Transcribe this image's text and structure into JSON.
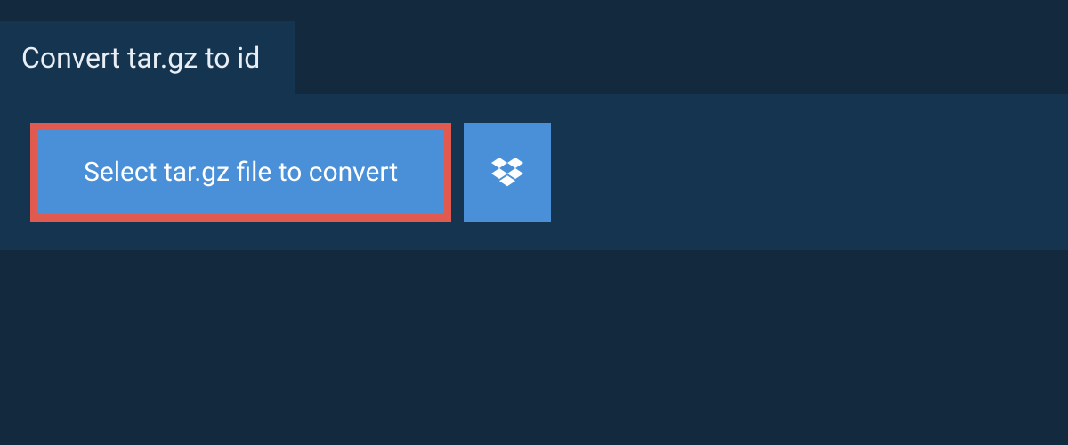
{
  "header": {
    "title": "Convert tar.gz to id"
  },
  "actions": {
    "select_file_label": "Select tar.gz file to convert"
  }
}
